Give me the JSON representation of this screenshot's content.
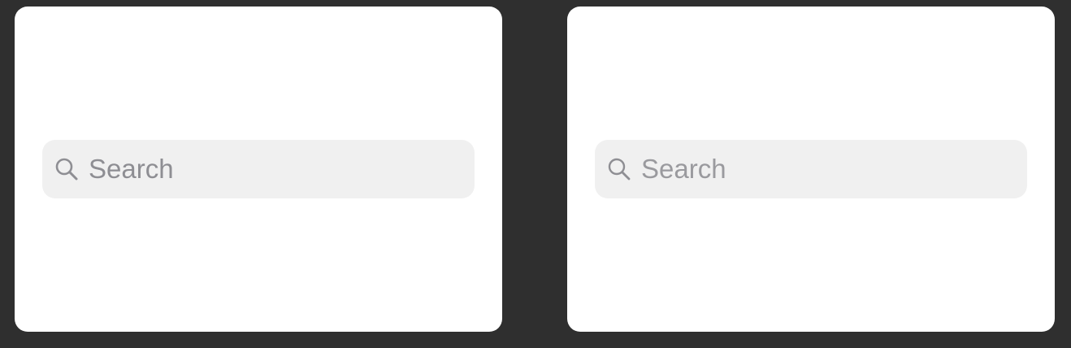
{
  "colors": {
    "background": "#2f2f2f",
    "panel": "#ffffff",
    "search_field": "#f0f0f0",
    "placeholder": "#8e8e93",
    "icon": "#8e8e93"
  },
  "panels": [
    {
      "search": {
        "placeholder": "Search",
        "value": "",
        "icon": "magnifying-glass"
      }
    },
    {
      "search": {
        "placeholder": "Search",
        "value": "",
        "icon": "magnifying-glass"
      }
    }
  ]
}
